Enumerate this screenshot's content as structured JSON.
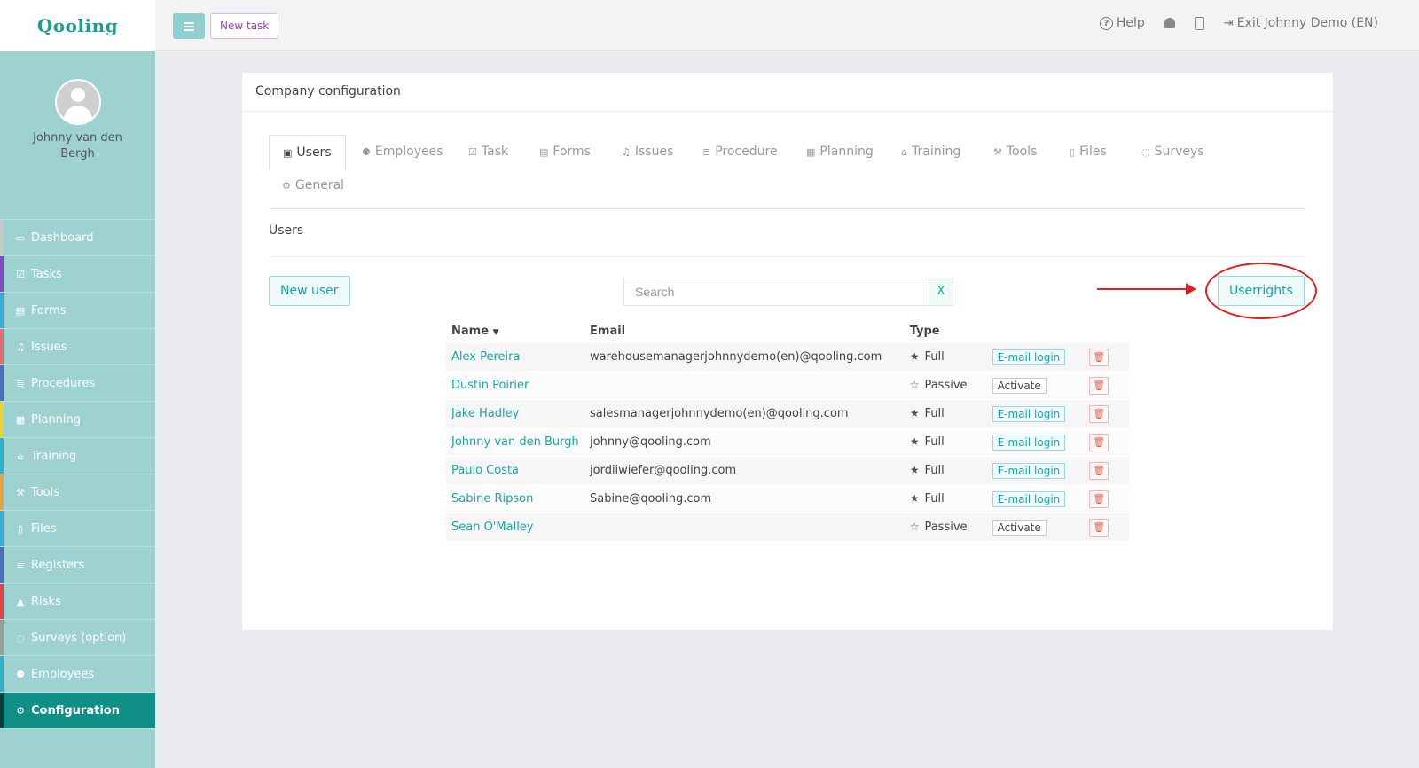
{
  "app": {
    "logo": "Qooling"
  },
  "topbar": {
    "new_task": "New task",
    "help": "Help",
    "exit": "Exit Johnny Demo (EN)"
  },
  "sidebar": {
    "user_name": "Johnny van den Bergh",
    "items": [
      {
        "label": "Dashboard",
        "icon": "monitor-icon",
        "color": "#c7c7c7"
      },
      {
        "label": "Tasks",
        "icon": "check-square-icon",
        "color": "#7d4bc2"
      },
      {
        "label": "Forms",
        "icon": "document-icon",
        "color": "#3ba9d9"
      },
      {
        "label": "Issues",
        "icon": "bell-icon",
        "color": "#e06e6e"
      },
      {
        "label": "Procedures",
        "icon": "list-icon",
        "color": "#4a6fc2"
      },
      {
        "label": "Planning",
        "icon": "calendar-icon",
        "color": "#e4d33a"
      },
      {
        "label": "Training",
        "icon": "graduation-cap-icon",
        "color": "#2cb3c6"
      },
      {
        "label": "Tools",
        "icon": "wrench-icon",
        "color": "#e6a045"
      },
      {
        "label": "Files",
        "icon": "file-icon",
        "color": "#3ba9d9"
      },
      {
        "label": "Registers",
        "icon": "lines-icon",
        "color": "#4a6fc2"
      },
      {
        "label": "Risks",
        "icon": "warning-icon",
        "color": "#e04545"
      },
      {
        "label": "Surveys (option)",
        "icon": "comment-icon",
        "color": "#9a9a9a"
      },
      {
        "label": "Employees",
        "icon": "users-icon",
        "color": "#2cb3c6"
      },
      {
        "label": "Configuration",
        "icon": "gear-icon",
        "color": "#0a3d3a"
      }
    ]
  },
  "card": {
    "title": "Company configuration",
    "tabs": [
      {
        "label": "Users",
        "icon": "id-card-icon"
      },
      {
        "label": "Employees",
        "icon": "users-icon"
      },
      {
        "label": "Task",
        "icon": "check-square-icon"
      },
      {
        "label": "Forms",
        "icon": "document-icon"
      },
      {
        "label": "Issues",
        "icon": "bell-icon"
      },
      {
        "label": "Procedure",
        "icon": "list-icon"
      },
      {
        "label": "Planning",
        "icon": "calendar-icon"
      },
      {
        "label": "Training",
        "icon": "graduation-cap-icon"
      },
      {
        "label": "Tools",
        "icon": "wrench-icon"
      },
      {
        "label": "Files",
        "icon": "file-icon"
      },
      {
        "label": "Surveys",
        "icon": "comment-icon"
      },
      {
        "label": "General",
        "icon": "gear-icon"
      }
    ],
    "section_title": "Users",
    "new_user": "New user",
    "search_placeholder": "Search",
    "search_clear": "X",
    "userrights": "Userrights"
  },
  "table": {
    "headers": {
      "name": "Name",
      "email": "Email",
      "type": "Type"
    },
    "rows": [
      {
        "name": "Alex Pereira",
        "email": "warehousemanagerjohnnydemo(en)@qooling.com",
        "type": "Full",
        "action": "E-mail login"
      },
      {
        "name": "Dustin Poirier",
        "email": "",
        "type": "Passive",
        "action": "Activate"
      },
      {
        "name": "Jake Hadley",
        "email": "salesmanagerjohnnydemo(en)@qooling.com",
        "type": "Full",
        "action": "E-mail login"
      },
      {
        "name": "Johnny van den Burgh",
        "email": "johnny@qooling.com",
        "type": "Full",
        "action": "E-mail login"
      },
      {
        "name": "Paulo Costa",
        "email": "jordiiwiefer@qooling.com",
        "type": "Full",
        "action": "E-mail login"
      },
      {
        "name": "Sabine Ripson",
        "email": "Sabine@qooling.com",
        "type": "Full",
        "action": "E-mail login"
      },
      {
        "name": "Sean O'Malley",
        "email": "",
        "type": "Passive",
        "action": "Activate"
      }
    ]
  },
  "colors": {
    "accent": "#1aa6a6",
    "sidebar": "#9ed2d1",
    "annotation": "#e02020"
  }
}
